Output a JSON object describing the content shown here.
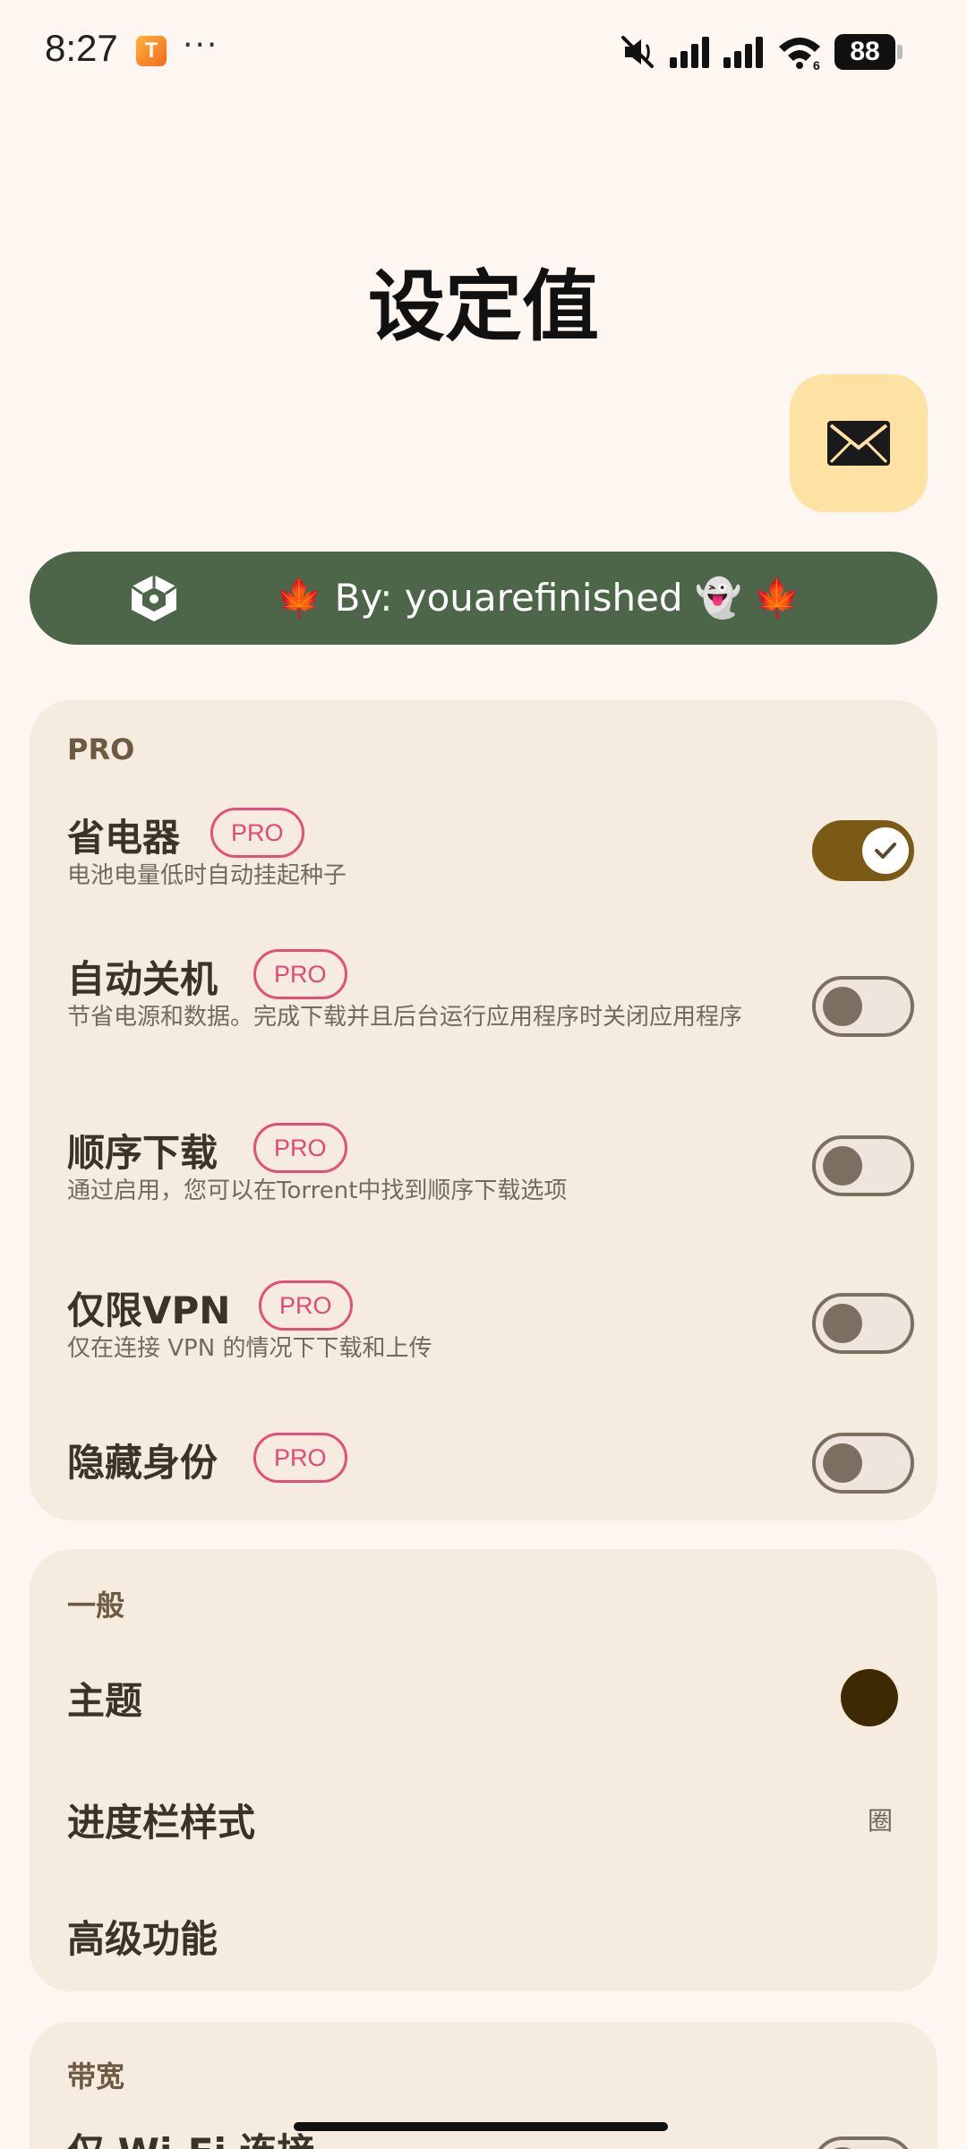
{
  "status_bar": {
    "time": "8:27",
    "app_icon_letter": "T",
    "dots": "···",
    "icons": [
      "mute-icon",
      "signal-icon",
      "signal-icon",
      "wifi-icon"
    ],
    "wifi_label": "6",
    "battery": "88"
  },
  "page": {
    "title": "设定值"
  },
  "banner": {
    "text": "🍁 By: youarefinished 👻 🍁",
    "icon": "box-logo-icon"
  },
  "colors": {
    "accent": "#7a5a14",
    "banner_bg": "#4d6649",
    "card_bg": "#f5ebdf",
    "pro_badge": "#e44f7a",
    "theme_swatch": "#3e2a02"
  },
  "sections": {
    "pro": {
      "title": "PRO",
      "items": [
        {
          "title": "省电器",
          "badge": "PRO",
          "subtitle": "电池电量低时自动挂起种子",
          "on": true
        },
        {
          "title": "自动关机",
          "badge": "PRO",
          "subtitle": "节省电源和数据。完成下载并且后台运行应用程序时关闭应用程序",
          "on": false
        },
        {
          "title": "顺序下载",
          "badge": "PRO",
          "subtitle": "通过启用，您可以在Torrent中找到顺序下载选项",
          "on": false
        },
        {
          "title": "仅限VPN",
          "badge": "PRO",
          "subtitle": "仅在连接 VPN 的情况下下载和上传",
          "on": false
        },
        {
          "title": "隐藏身份",
          "badge": "PRO",
          "on": false
        }
      ]
    },
    "general": {
      "title": "一般",
      "items": [
        {
          "title": "主题"
        },
        {
          "title": "进度栏样式",
          "value": "圈"
        },
        {
          "title": "高级功能"
        }
      ]
    },
    "bandwidth": {
      "title": "带宽",
      "items": [
        {
          "title": "仅 Wi-Fi 连接"
        }
      ]
    }
  }
}
